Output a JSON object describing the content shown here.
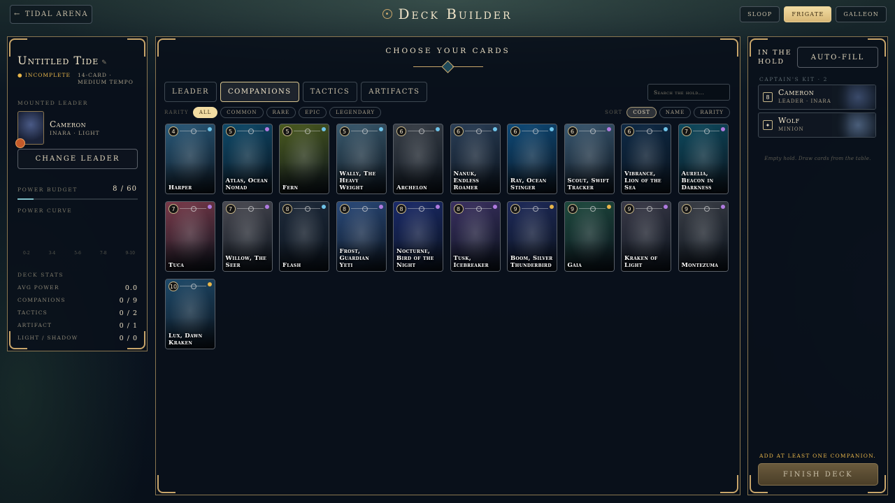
{
  "topbar": {
    "back_label": "Tidal Arena",
    "title": "Deck Builder",
    "ship_classes": [
      {
        "label": "Sloop",
        "active": false
      },
      {
        "label": "Frigate",
        "active": true
      },
      {
        "label": "Galleon",
        "active": false
      }
    ]
  },
  "left": {
    "deck_name": "Untitled Tide",
    "edit_icon": "pencil-icon",
    "status": "● Incomplete",
    "meta_line1": "14-Card ·",
    "meta_line2": "Medium Tempo",
    "mounted_leader_label": "Mounted Leader",
    "leader_name": "Cameron",
    "leader_sub": "Inara · Light",
    "change_leader": "Change Leader",
    "power_budget_label": "Power Budget",
    "power_budget_value": "8 / 60",
    "power_budget_fraction": 0.133,
    "power_curve_label": "Power Curve",
    "curve_ticks": [
      "0-2",
      "3-4",
      "5-6",
      "7-8",
      "9-10"
    ],
    "deck_stats_label": "Deck Stats",
    "stats": [
      {
        "label": "Avg Power",
        "value": "0.0"
      },
      {
        "label": "Companions",
        "value": "0 / 9"
      },
      {
        "label": "Tactics",
        "value": "0 / 2"
      },
      {
        "label": "Artifact",
        "value": "0 / 1"
      },
      {
        "label": "Light / Shadow",
        "value": "0 / 0"
      }
    ]
  },
  "center": {
    "heading": "Choose Your Cards",
    "tabs": [
      {
        "label": "Leader",
        "active": false
      },
      {
        "label": "Companions",
        "active": true
      },
      {
        "label": "Tactics",
        "active": false
      },
      {
        "label": "Artifacts",
        "active": false
      }
    ],
    "search_placeholder": "Search the hold...",
    "rarity_label": "Rarity",
    "rarity_filters": [
      {
        "label": "All",
        "active": true
      },
      {
        "label": "Common",
        "active": false
      },
      {
        "label": "Rare",
        "active": false
      },
      {
        "label": "Epic",
        "active": false
      },
      {
        "label": "Legendary",
        "active": false
      }
    ],
    "sort_label": "Sort",
    "sort_options": [
      {
        "label": "Cost",
        "active": true
      },
      {
        "label": "Name",
        "active": false
      },
      {
        "label": "Rarity",
        "active": false
      }
    ],
    "cards": [
      {
        "cost": "4",
        "name": "Harper",
        "rarity": "#6fc3e8",
        "bg": "#2a5a7a"
      },
      {
        "cost": "5",
        "name": "Atlas, Ocean Nomad",
        "rarity": "#b07be0",
        "bg": "#0e4a6a"
      },
      {
        "cost": "5",
        "name": "Fern",
        "rarity": "#6fc3e8",
        "bg": "#4a5a1e"
      },
      {
        "cost": "5",
        "name": "Wally, The Heavy Weight",
        "rarity": "#6fc3e8",
        "bg": "#3a5a6e"
      },
      {
        "cost": "6",
        "name": "Archelon",
        "rarity": "#6fc3e8",
        "bg": "#3a4048"
      },
      {
        "cost": "6",
        "name": "Nanuk, Endless Roamer",
        "rarity": "#6fc3e8",
        "bg": "#2a3e56"
      },
      {
        "cost": "6",
        "name": "Ray, Ocean Stinger",
        "rarity": "#6fc3e8",
        "bg": "#0e4a78"
      },
      {
        "cost": "6",
        "name": "Scout, Swift Tracker",
        "rarity": "#b07be0",
        "bg": "#3a5870"
      },
      {
        "cost": "6",
        "name": "Vibrance, Lion of the Sea",
        "rarity": "#6fc3e8",
        "bg": "#0e2a46"
      },
      {
        "cost": "7",
        "name": "Aurelia, Beacon in Darkness",
        "rarity": "#b07be0",
        "bg": "#0e4a5e"
      },
      {
        "cost": "7",
        "name": "Tuca",
        "rarity": "#b07be0",
        "bg": "#7a3a4a"
      },
      {
        "cost": "7",
        "name": "Willow, The Seer",
        "rarity": "#b07be0",
        "bg": "#4a4a52"
      },
      {
        "cost": "8",
        "name": "Flash",
        "rarity": "#6fc3e8",
        "bg": "#1e2a3a"
      },
      {
        "cost": "8",
        "name": "Frost, Guardian Yeti",
        "rarity": "#b07be0",
        "bg": "#2a4a7a"
      },
      {
        "cost": "8",
        "name": "Nocturne, Bird of the Night",
        "rarity": "#b07be0",
        "bg": "#1a2a6a"
      },
      {
        "cost": "8",
        "name": "Tusk, Icebreaker",
        "rarity": "#b07be0",
        "bg": "#3a3060"
      },
      {
        "cost": "9",
        "name": "Boom, Silver Thunderbird",
        "rarity": "#e8b64a",
        "bg": "#1e2a5a"
      },
      {
        "cost": "9",
        "name": "Gaia",
        "rarity": "#e8b64a",
        "bg": "#1e4a3e"
      },
      {
        "cost": "9",
        "name": "Kraken of Light",
        "rarity": "#b07be0",
        "bg": "#3a3a48"
      },
      {
        "cost": "9",
        "name": "Montezuma",
        "rarity": "#b07be0",
        "bg": "#3a3e46"
      },
      {
        "cost": "10",
        "name": "Lux, Dawn Kraken",
        "rarity": "#e8b64a",
        "bg": "#1e4a6a"
      }
    ]
  },
  "right": {
    "hold_title_line1": "In the",
    "hold_title_line2": "Hold",
    "autofill": "Auto-Fill",
    "kit_label": "Captain's Kit · 2",
    "kit": [
      {
        "cost": "8",
        "name": "Cameron",
        "sub": "Leader · Inara",
        "art": "#3a4a6a"
      },
      {
        "cost": "✦",
        "name": "Wolf",
        "sub": "Minion",
        "art": "#4a5e7a"
      }
    ],
    "empty_text": "Empty hold. Draw cards from the table.",
    "hint": "Add at least one companion.",
    "finish": "Finish Deck"
  }
}
